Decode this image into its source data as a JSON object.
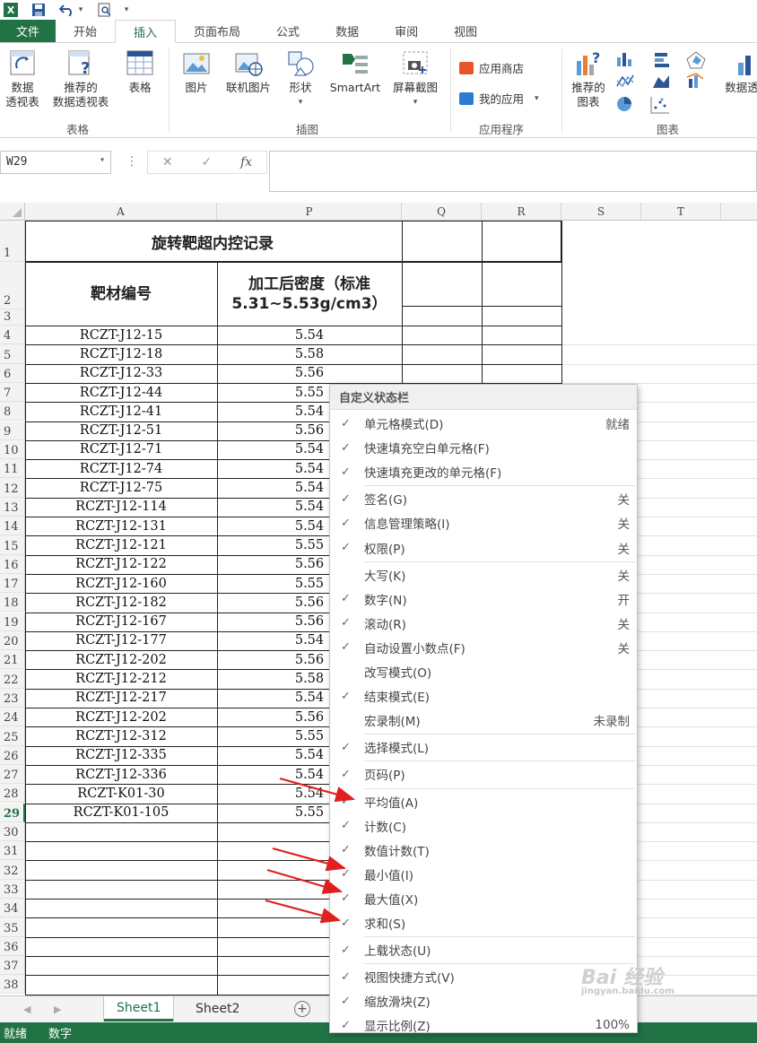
{
  "app": {
    "logo_letter": "X",
    "accent_color": "#217346",
    "qat": {
      "save_icon": "save-icon",
      "undo_icon": "undo-icon",
      "print_preview_icon": "print-preview-icon",
      "dropdown": "▾"
    }
  },
  "tabs": [
    {
      "label": "文件"
    },
    {
      "label": "开始"
    },
    {
      "label": "插入"
    },
    {
      "label": "页面布局"
    },
    {
      "label": "公式"
    },
    {
      "label": "数据"
    },
    {
      "label": "审阅"
    },
    {
      "label": "视图"
    }
  ],
  "active_tab": "插入",
  "ribbon": {
    "pivot_table": "数据\n透视表",
    "recommended_pivot": "推荐的\n数据透视表",
    "table": "表格",
    "group_table": "表格",
    "picture": "图片",
    "online_picture": "联机图片",
    "shapes": "形状",
    "smartart": "SmartArt",
    "screenshot": "屏幕截图",
    "group_illustrations": "插图",
    "app_store": "应用商店",
    "my_apps": "我的应用",
    "group_apps": "应用程序",
    "recommended_charts": "推荐的\n图表",
    "group_charts": "图表",
    "pivot_chart": "数据透"
  },
  "formula_bar": {
    "name_box": "W29",
    "cancel": "✕",
    "enter": "✓",
    "fx": "fx",
    "value": ""
  },
  "columns": [
    "A",
    "P",
    "Q",
    "R",
    "S",
    "T"
  ],
  "sheet": {
    "title": "旋转靶超内控记录",
    "header_a": "靶材编号",
    "header_p": "加工后密度（标准\n5.31~5.53g/cm3）",
    "rows": [
      {
        "row": "4",
        "a": "RCZT-J12-15",
        "p": "5.54"
      },
      {
        "row": "5",
        "a": "RCZT-J12-18",
        "p": "5.58"
      },
      {
        "row": "6",
        "a": "RCZT-J12-33",
        "p": "5.56"
      },
      {
        "row": "7",
        "a": "RCZT-J12-44",
        "p": "5.55"
      },
      {
        "row": "8",
        "a": "RCZT-J12-41",
        "p": "5.54"
      },
      {
        "row": "9",
        "a": "RCZT-J12-51",
        "p": "5.56"
      },
      {
        "row": "10",
        "a": "RCZT-J12-71",
        "p": "5.54"
      },
      {
        "row": "11",
        "a": "RCZT-J12-74",
        "p": "5.54"
      },
      {
        "row": "12",
        "a": "RCZT-J12-75",
        "p": "5.54"
      },
      {
        "row": "13",
        "a": "RCZT-J12-114",
        "p": "5.54"
      },
      {
        "row": "14",
        "a": "RCZT-J12-131",
        "p": "5.54"
      },
      {
        "row": "15",
        "a": "RCZT-J12-121",
        "p": "5.55"
      },
      {
        "row": "16",
        "a": "RCZT-J12-122",
        "p": "5.56"
      },
      {
        "row": "17",
        "a": "RCZT-J12-160",
        "p": "5.55"
      },
      {
        "row": "18",
        "a": "RCZT-J12-182",
        "p": "5.56"
      },
      {
        "row": "19",
        "a": "RCZT-J12-167",
        "p": "5.56"
      },
      {
        "row": "20",
        "a": "RCZT-J12-177",
        "p": "5.54"
      },
      {
        "row": "21",
        "a": "RCZT-J12-202",
        "p": "5.56"
      },
      {
        "row": "22",
        "a": "RCZT-J12-212",
        "p": "5.58"
      },
      {
        "row": "23",
        "a": "RCZT-J12-217",
        "p": "5.54"
      },
      {
        "row": "24",
        "a": "RCZT-J12-202",
        "p": "5.56"
      },
      {
        "row": "25",
        "a": "RCZT-J12-312",
        "p": "5.55"
      },
      {
        "row": "26",
        "a": "RCZT-J12-335",
        "p": "5.54"
      },
      {
        "row": "27",
        "a": "RCZT-J12-336",
        "p": "5.54"
      },
      {
        "row": "28",
        "a": "RCZT-K01-30",
        "p": "5.54"
      },
      {
        "row": "29",
        "a": "RCZT-K01-105",
        "p": "5.55"
      }
    ],
    "empty_rows": [
      "30",
      "31",
      "32",
      "33",
      "34",
      "35",
      "36",
      "37",
      "38"
    ],
    "selected_row": "29"
  },
  "sheet_tabs": [
    {
      "label": "Sheet1"
    },
    {
      "label": "Sheet2"
    }
  ],
  "active_sheet": "Sheet1",
  "add_sheet": "+",
  "status_bar": {
    "mode": "就绪",
    "num": "数字"
  },
  "context_menu": {
    "title": "自定义状态栏",
    "items": [
      {
        "label": "单元格模式(D)",
        "checked": true,
        "value": "就绪"
      },
      {
        "label": "快速填充空白单元格(F)",
        "checked": true,
        "value": ""
      },
      {
        "label": "快速填充更改的单元格(F)",
        "checked": true,
        "value": ""
      },
      {
        "label": "签名(G)",
        "checked": true,
        "value": "关"
      },
      {
        "label": "信息管理策略(I)",
        "checked": true,
        "value": "关"
      },
      {
        "label": "权限(P)",
        "checked": true,
        "value": "关"
      },
      {
        "label": "大写(K)",
        "checked": false,
        "value": "关"
      },
      {
        "label": "数字(N)",
        "checked": true,
        "value": "开"
      },
      {
        "label": "滚动(R)",
        "checked": true,
        "value": "关"
      },
      {
        "label": "自动设置小数点(F)",
        "checked": true,
        "value": "关"
      },
      {
        "label": "改写模式(O)",
        "checked": false,
        "value": ""
      },
      {
        "label": "结束模式(E)",
        "checked": true,
        "value": ""
      },
      {
        "label": "宏录制(M)",
        "checked": false,
        "value": "未录制"
      },
      {
        "label": "选择模式(L)",
        "checked": true,
        "value": ""
      },
      {
        "label": "页码(P)",
        "checked": true,
        "value": ""
      },
      {
        "label": "平均值(A)",
        "checked": true,
        "value": ""
      },
      {
        "label": "计数(C)",
        "checked": true,
        "value": ""
      },
      {
        "label": "数值计数(T)",
        "checked": true,
        "value": ""
      },
      {
        "label": "最小值(I)",
        "checked": true,
        "value": ""
      },
      {
        "label": "最大值(X)",
        "checked": true,
        "value": ""
      },
      {
        "label": "求和(S)",
        "checked": true,
        "value": ""
      },
      {
        "label": "上载状态(U)",
        "checked": true,
        "value": ""
      },
      {
        "label": "视图快捷方式(V)",
        "checked": true,
        "value": ""
      },
      {
        "label": "缩放滑块(Z)",
        "checked": true,
        "value": ""
      },
      {
        "label": "显示比例(Z)",
        "checked": true,
        "value": "100%"
      }
    ],
    "check_glyph": "✓"
  },
  "annotation_color": "#e02020",
  "watermark": {
    "main": "Bai 经验",
    "sub": "jingyan.baidu.com"
  }
}
